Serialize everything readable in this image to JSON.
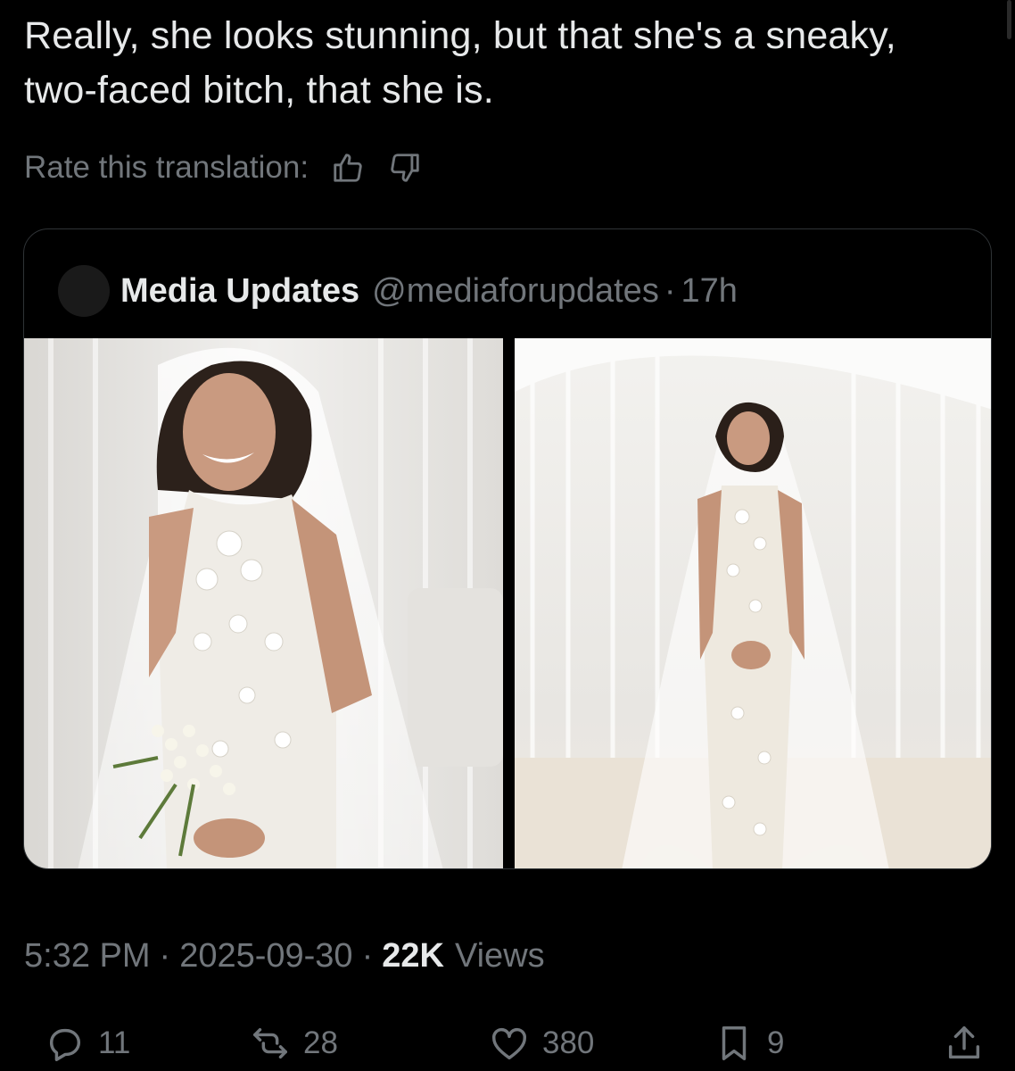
{
  "tweet": {
    "text": "Really, she looks stunning, but that she's a sneaky, two-faced bitch, that she is."
  },
  "translation": {
    "rate_label": "Rate this translation:"
  },
  "quote": {
    "name": "Media Updates",
    "handle": "@mediaforupdates",
    "separator": "·",
    "time": "17h"
  },
  "meta": {
    "time": "5:32 PM",
    "separator": "·",
    "date": "2025-09-30",
    "views_count": "22K",
    "views_label": "Views"
  },
  "actions": {
    "replies": "11",
    "reposts": "28",
    "likes": "380",
    "bookmarks": "9"
  },
  "icons": [
    "thumbs-up-icon",
    "thumbs-down-icon",
    "reply-icon",
    "repost-icon",
    "like-icon",
    "bookmark-icon",
    "share-icon"
  ]
}
